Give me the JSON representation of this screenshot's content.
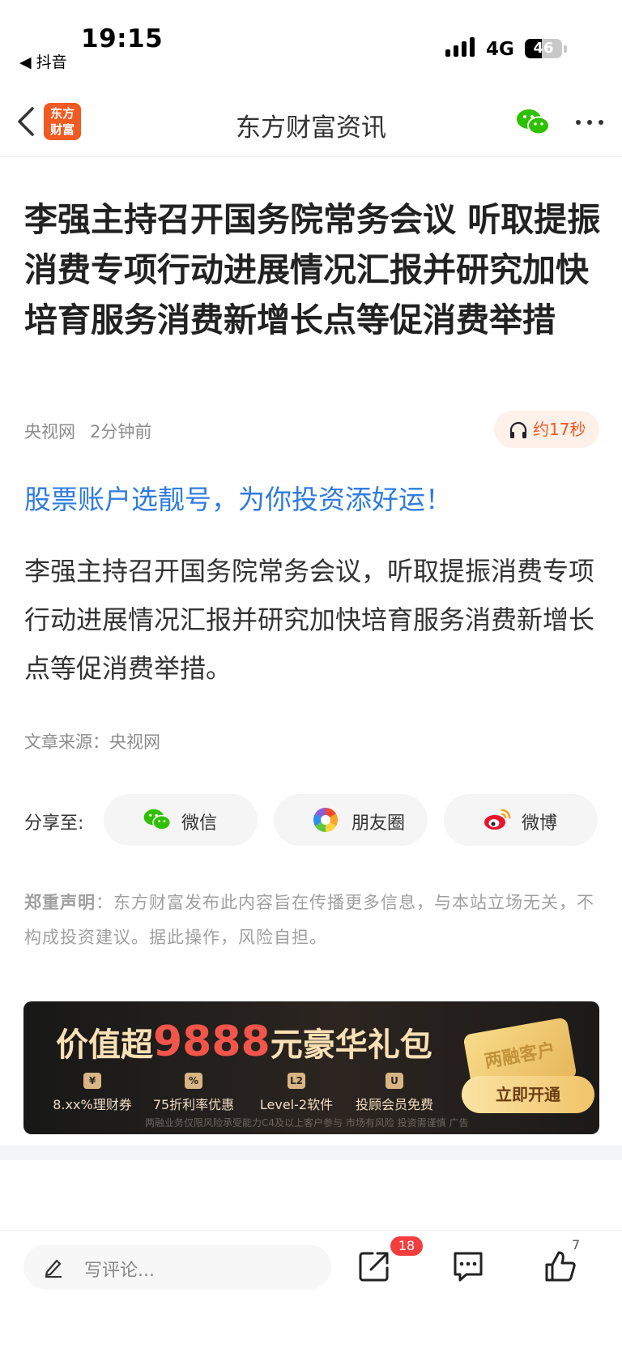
{
  "status_bar": {
    "time": "19:15",
    "back_app": "◀ 抖音",
    "network": "4G",
    "battery": "46",
    "battery_level": 0.46
  },
  "nav": {
    "logo_text": "东方财富",
    "title": "东方财富资讯"
  },
  "article": {
    "headline": "李强主持召开国务院常务会议 听取提振消费专项行动进展情况汇报并研究加快培育服务消费新增长点等促消费举措",
    "source": "央视网",
    "time_ago": "2分钟前",
    "audio_label": "约17秒",
    "promo_link": "股票账户选靓号，为你投资添好运！",
    "body": "李强主持召开国务院常务会议，听取提振消费专项行动进展情况汇报并研究加快培育服务消费新增长点等促消费举措。",
    "origin": "文章来源：央视网"
  },
  "share": {
    "label": "分享至:",
    "wechat": "微信",
    "moments": "朋友圈",
    "weibo": "微博"
  },
  "disclaimer": {
    "title": "郑重声明",
    "text": "：东方财富发布此内容旨在传播更多信息，与本站立场无关，不构成投资建议。据此操作，风险自担。"
  },
  "banner": {
    "title_pre": "价值超",
    "title_num": "9888",
    "title_post": "元豪华礼包",
    "features": [
      {
        "icon": "¥",
        "label": "8.xx%理财券"
      },
      {
        "icon": "%",
        "label": "75折利率优惠"
      },
      {
        "icon": "L2",
        "label": "Level-2软件"
      },
      {
        "icon": "U",
        "label": "投顾会员免费"
      }
    ],
    "card_text": "两融客户",
    "cta": "立即开通",
    "footnote": "两融业务仅限风险承受能力C4及以上客户参与 市场有风险 投资需谨慎 广告"
  },
  "bottom_bar": {
    "comment_placeholder": "写评论...",
    "share_badge": "18",
    "like_count": "7"
  }
}
